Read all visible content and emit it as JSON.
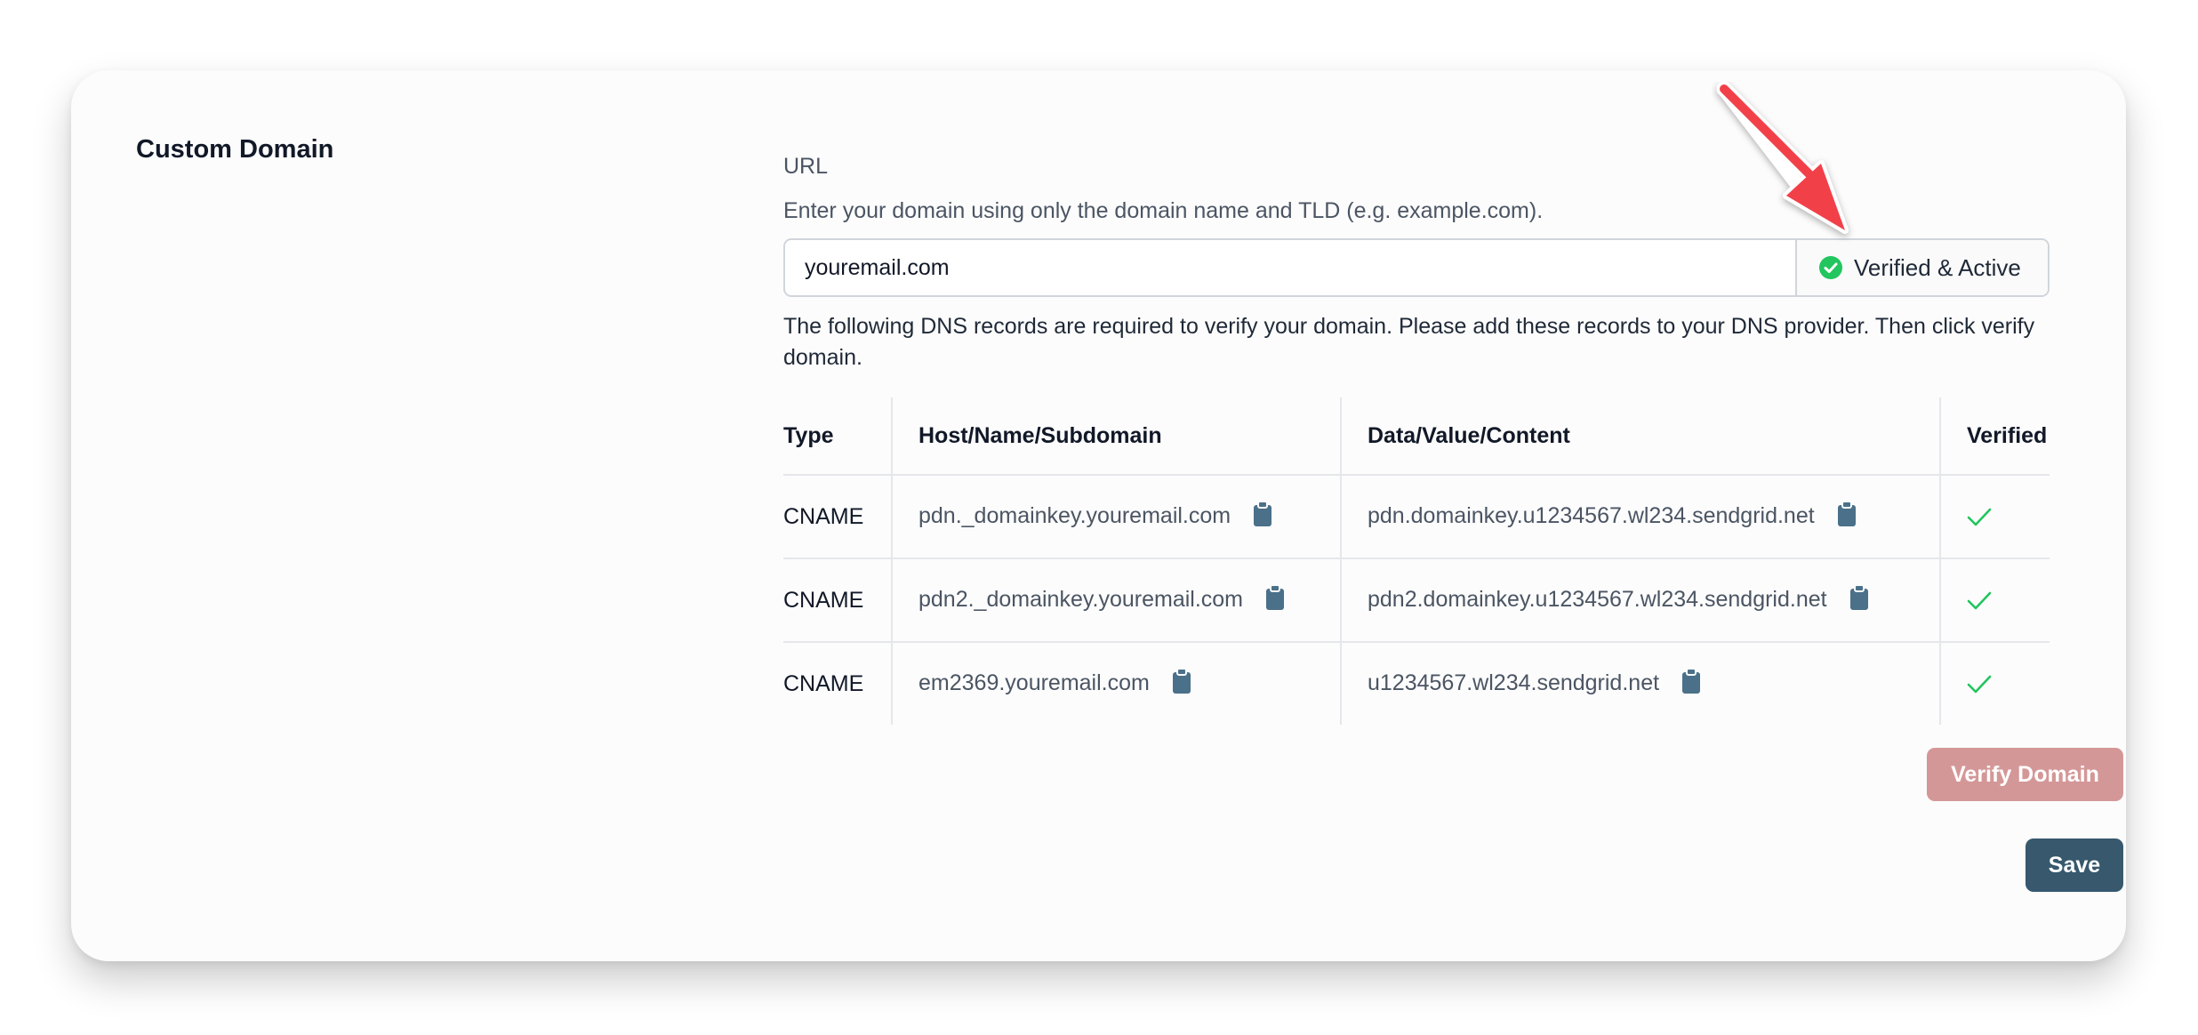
{
  "section": {
    "title": "Custom Domain"
  },
  "url_field": {
    "label": "URL",
    "help": "Enter your domain using only the domain name and TLD (e.g. example.com).",
    "value": "youremail.com",
    "status": {
      "text": "Verified & Active",
      "icon": "check-circle-icon",
      "color": "#22c55e"
    }
  },
  "dns_note": "The following DNS records are required to verify your domain. Please add these records to your DNS provider. Then click verify domain.",
  "dns_table": {
    "headers": [
      "Type",
      "Host/Name/Subdomain",
      "Data/Value/Content",
      "Verified"
    ],
    "rows": [
      {
        "type": "CNAME",
        "host": "pdn._domainkey.youremail.com",
        "data": "pdn.domainkey.u1234567.wl234.sendgrid.net",
        "verified": true
      },
      {
        "type": "CNAME",
        "host": "pdn2._domainkey.youremail.com",
        "data": "pdn2.domainkey.u1234567.wl234.sendgrid.net",
        "verified": true
      },
      {
        "type": "CNAME",
        "host": "em2369.youremail.com",
        "data": "u1234567.wl234.sendgrid.net",
        "verified": true
      }
    ],
    "copy_icon": "clipboard-icon",
    "verified_icon": "check-icon"
  },
  "buttons": {
    "verify": "Verify Domain",
    "save": "Save"
  },
  "colors": {
    "verify_button": "#d49797",
    "save_button": "#37586d",
    "clipboard": "#4b7089",
    "check": "#22c55e",
    "annotation_arrow": "#f2404a"
  }
}
